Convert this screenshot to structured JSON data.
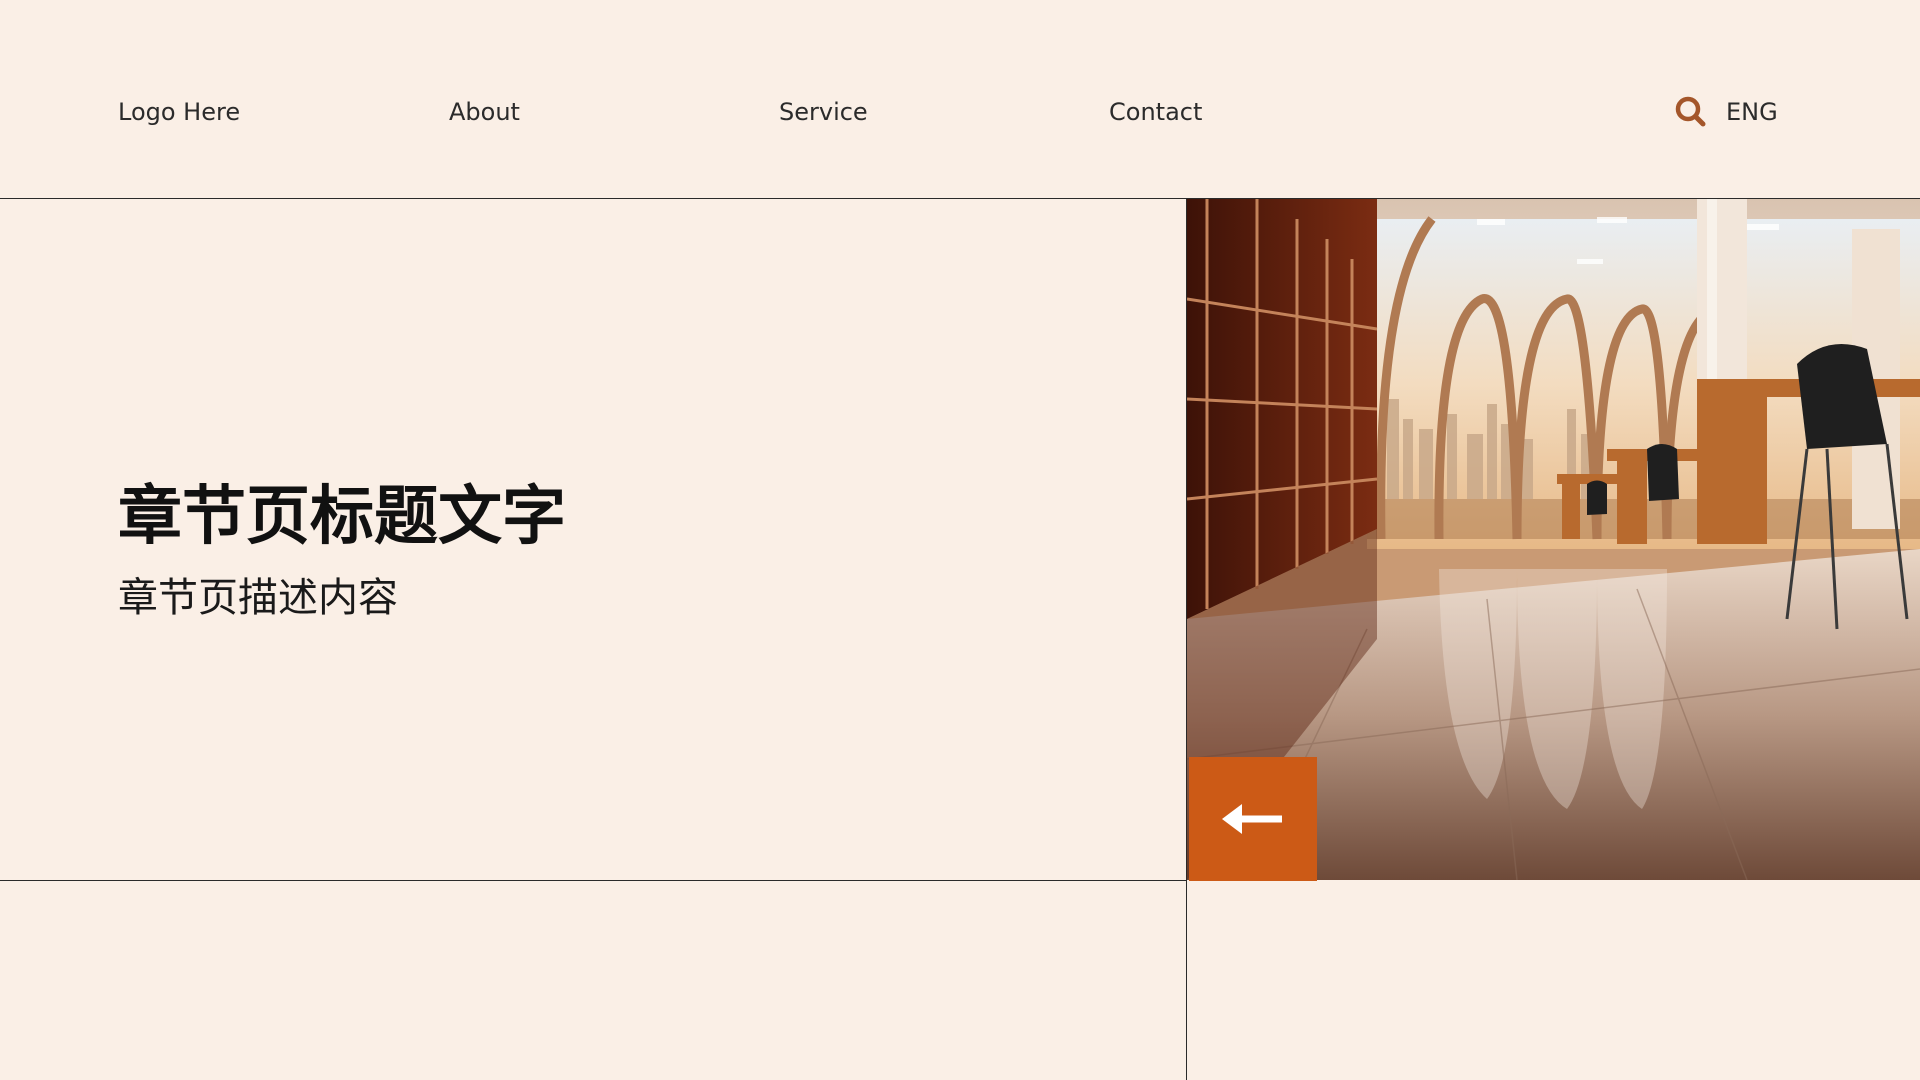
{
  "header": {
    "logo": "Logo Here",
    "nav": {
      "about": "About",
      "service": "Service",
      "contact": "Contact"
    },
    "search_icon": "search-icon",
    "language": "ENG"
  },
  "section": {
    "title": "章节页标题文字",
    "description": "章节页描述内容"
  },
  "photo": {
    "subject": "office-interior-photo"
  },
  "back_button": {
    "icon": "arrow-left-icon"
  },
  "colors": {
    "background": "#FAEFE6",
    "accent": "#CC5A16",
    "icon": "#A4562A",
    "text": "#111111",
    "line": "#2A2A2A"
  }
}
